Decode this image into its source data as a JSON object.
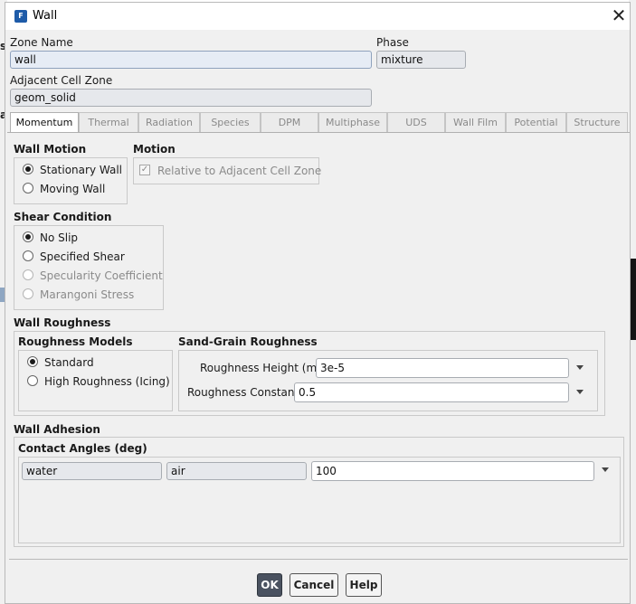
{
  "window": {
    "title": "Wall",
    "app_icon_letter": "F"
  },
  "background_glyphs": [
    "st",
    "a"
  ],
  "zone_name": {
    "label": "Zone Name",
    "value": "wall"
  },
  "phase": {
    "label": "Phase",
    "value": "mixture"
  },
  "adjacent_cell_zone": {
    "label": "Adjacent Cell Zone",
    "value": "geom_solid"
  },
  "tabs": [
    {
      "label": "Momentum",
      "active": true
    },
    {
      "label": "Thermal"
    },
    {
      "label": "Radiation"
    },
    {
      "label": "Species"
    },
    {
      "label": "DPM"
    },
    {
      "label": "Multiphase"
    },
    {
      "label": "UDS"
    },
    {
      "label": "Wall Film"
    },
    {
      "label": "Potential"
    },
    {
      "label": "Structure"
    }
  ],
  "wall_motion": {
    "title": "Wall Motion",
    "options": [
      {
        "label": "Stationary Wall",
        "selected": true
      },
      {
        "label": "Moving Wall",
        "selected": false
      }
    ]
  },
  "motion": {
    "title": "Motion",
    "relative_checkbox": {
      "label": "Relative to Adjacent Cell Zone",
      "checked": true,
      "enabled": false
    }
  },
  "shear_condition": {
    "title": "Shear Condition",
    "options": [
      {
        "label": "No Slip",
        "selected": true,
        "enabled": true
      },
      {
        "label": "Specified Shear",
        "selected": false,
        "enabled": true
      },
      {
        "label": "Specularity Coefficient",
        "selected": false,
        "enabled": false
      },
      {
        "label": "Marangoni Stress",
        "selected": false,
        "enabled": false
      }
    ]
  },
  "wall_roughness": {
    "title": "Wall Roughness",
    "models_title": "Roughness Models",
    "models": [
      {
        "label": "Standard",
        "selected": true
      },
      {
        "label": "High Roughness (Icing)",
        "selected": false
      }
    ],
    "sand_grain_title": "Sand-Grain Roughness",
    "height": {
      "label": "Roughness Height (m)",
      "value": "3e-5"
    },
    "constant": {
      "label": "Roughness Constant",
      "value": "0.5"
    }
  },
  "wall_adhesion": {
    "title": "Wall Adhesion",
    "contact_angles_title": "Contact Angles (deg)",
    "row": {
      "phase1": "water",
      "phase2": "air",
      "value": "100"
    }
  },
  "buttons": {
    "ok": "OK",
    "cancel": "Cancel",
    "help": "Help"
  }
}
